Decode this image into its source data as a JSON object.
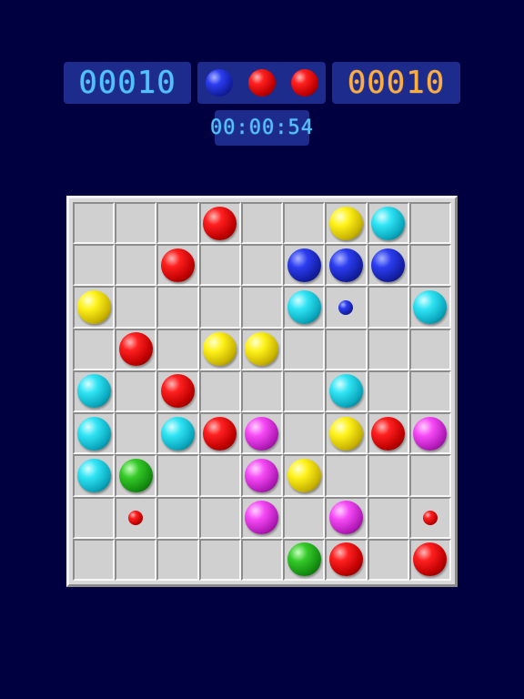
{
  "hud": {
    "score": "00010",
    "best_score": "00010",
    "timer": "00:00:54",
    "next_balls": [
      "blue",
      "red",
      "red"
    ]
  },
  "board": {
    "rows": 9,
    "cols": 9,
    "cells": [
      [
        "",
        "",
        "",
        "red",
        "",
        "",
        "yellow",
        "cyan",
        ""
      ],
      [
        "",
        "",
        "red",
        "",
        "",
        "blue",
        "blue",
        "blue",
        ""
      ],
      [
        "yellow",
        "",
        "",
        "",
        "",
        "cyan",
        "blue-small",
        "",
        "cyan"
      ],
      [
        "",
        "red",
        "",
        "yellow",
        "yellow",
        "",
        "",
        "",
        ""
      ],
      [
        "cyan",
        "",
        "red",
        "",
        "",
        "",
        "cyan",
        "",
        ""
      ],
      [
        "cyan",
        "",
        "cyan",
        "red",
        "magenta",
        "",
        "yellow",
        "red",
        "magenta"
      ],
      [
        "cyan",
        "green",
        "",
        "",
        "magenta",
        "yellow",
        "",
        "",
        ""
      ],
      [
        "",
        "red-small",
        "",
        "",
        "magenta",
        "",
        "magenta",
        "",
        "red-small"
      ],
      [
        "",
        "",
        "",
        "",
        "",
        "green",
        "red",
        "",
        "red"
      ]
    ]
  }
}
